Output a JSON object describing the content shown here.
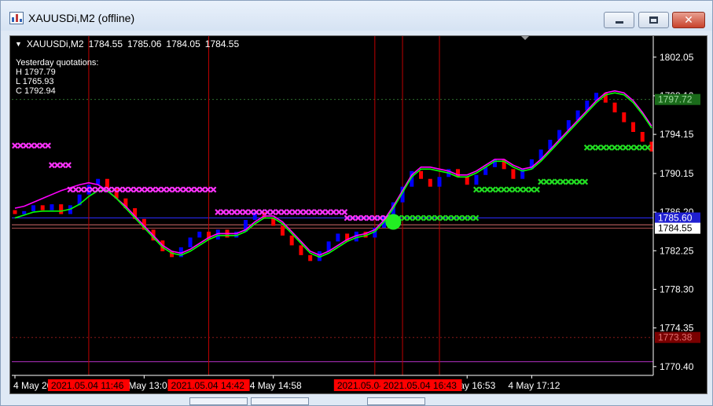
{
  "window": {
    "title": "XAUUSDi,M2 (offline)",
    "buttons": {
      "minimize": "minimize",
      "maximize": "maximize",
      "close": "✕"
    }
  },
  "header": {
    "symbol": "XAUUSDi,M2",
    "open": "1784.55",
    "high": "1785.06",
    "low": "1784.05",
    "close": "1784.55"
  },
  "yesterday": {
    "title": "Yesterday quotations:",
    "high": "H 1797.79",
    "low": "L 1765.93",
    "close": "C 1792.94"
  },
  "colors": {
    "background": "#000000",
    "bull_bar": "#0000ff",
    "bear_bar": "#ff0000",
    "upper_line": "#ff00ff",
    "lower_line": "#00ff00",
    "cross_bear": "#ff33ff",
    "cross_bull": "#22dd22",
    "vline": "#c00000",
    "date_label_bg": "#ff0000",
    "h_label_bg": "#1a6b1a",
    "l_label_bg": "#7a0000",
    "blue_level_bg": "#1f1fd0",
    "current_price_bg": "#ffffff"
  },
  "chart_data": {
    "type": "candlestick-xover",
    "y_ticks": [
      "1802.05",
      "1798.10",
      "1794.15",
      "1790.15",
      "1786.20",
      "1782.25",
      "1778.30",
      "1774.35",
      "1770.40"
    ],
    "y_tick_values": [
      1802.05,
      1798.1,
      1794.15,
      1790.15,
      1786.2,
      1782.25,
      1778.3,
      1774.35,
      1770.4
    ],
    "ylim": [
      1769.5,
      1804.2
    ],
    "x_ticks": [
      "4 May 2021",
      "4 May 13:02",
      "4 May 14:58",
      "4 May 16:53",
      "4 May 17:12"
    ],
    "x_tick_bar_index": [
      0,
      14,
      28,
      49,
      56
    ],
    "time_labels": [
      "2021.05.04 11:46",
      "2021.05.04 14:42",
      "2021.05.04 15:52",
      "2021.05.04 16:43"
    ],
    "time_label_bar_index": [
      8,
      21,
      39,
      44
    ],
    "vline_bar_index": [
      8,
      21,
      39,
      42,
      46
    ],
    "levels": [
      {
        "name": "yesterday-high",
        "value": 1797.72,
        "label": "1797.72",
        "style": "dotted-green"
      },
      {
        "name": "blue-level",
        "value": 1785.6,
        "label": "1785.60",
        "style": "solid-blue"
      },
      {
        "name": "current-price",
        "value": 1784.55,
        "label": "1784.55",
        "style": "solid-brown"
      },
      {
        "name": "pink-level",
        "value": 1784.9,
        "label": "",
        "style": "solid-pink"
      },
      {
        "name": "yesterday-low",
        "value": 1773.38,
        "label": "1773.38",
        "style": "dotted-red"
      },
      {
        "name": "purple-level",
        "value": 1770.9,
        "label": "",
        "style": "solid-purple"
      }
    ],
    "bars": [
      {
        "o": 1786.4,
        "c": 1786.0,
        "h": 1786.7,
        "l": 1785.7
      },
      {
        "o": 1786.0,
        "c": 1786.3,
        "h": 1786.6,
        "l": 1785.8
      },
      {
        "o": 1786.3,
        "c": 1786.9,
        "h": 1787.3,
        "l": 1786.1
      },
      {
        "o": 1786.9,
        "c": 1786.4,
        "h": 1787.1,
        "l": 1786.2
      },
      {
        "o": 1786.4,
        "c": 1787.0,
        "h": 1787.4,
        "l": 1786.2
      },
      {
        "o": 1787.0,
        "c": 1786.0,
        "h": 1787.2,
        "l": 1785.8
      },
      {
        "o": 1786.0,
        "c": 1786.9,
        "h": 1787.3,
        "l": 1785.9
      },
      {
        "o": 1786.9,
        "c": 1788.0,
        "h": 1788.3,
        "l": 1786.7
      },
      {
        "o": 1788.0,
        "c": 1789.0,
        "h": 1789.4,
        "l": 1787.8
      },
      {
        "o": 1789.0,
        "c": 1789.6,
        "h": 1790.0,
        "l": 1788.8
      },
      {
        "o": 1789.6,
        "c": 1788.6,
        "h": 1789.8,
        "l": 1788.4
      },
      {
        "o": 1788.6,
        "c": 1787.6,
        "h": 1788.8,
        "l": 1787.4
      },
      {
        "o": 1787.6,
        "c": 1786.6,
        "h": 1787.8,
        "l": 1786.3
      },
      {
        "o": 1786.6,
        "c": 1785.5,
        "h": 1786.8,
        "l": 1785.2
      },
      {
        "o": 1785.5,
        "c": 1784.4,
        "h": 1785.7,
        "l": 1784.1
      },
      {
        "o": 1784.4,
        "c": 1783.3,
        "h": 1784.6,
        "l": 1783.0
      },
      {
        "o": 1783.3,
        "c": 1782.2,
        "h": 1783.5,
        "l": 1781.9
      },
      {
        "o": 1782.2,
        "c": 1781.6,
        "h": 1782.5,
        "l": 1781.3
      },
      {
        "o": 1781.6,
        "c": 1782.6,
        "h": 1782.9,
        "l": 1781.4
      },
      {
        "o": 1782.6,
        "c": 1783.6,
        "h": 1783.9,
        "l": 1782.4
      },
      {
        "o": 1783.6,
        "c": 1784.2,
        "h": 1784.5,
        "l": 1783.3
      },
      {
        "o": 1784.2,
        "c": 1783.4,
        "h": 1784.4,
        "l": 1783.1
      },
      {
        "o": 1783.4,
        "c": 1784.4,
        "h": 1784.7,
        "l": 1783.2
      },
      {
        "o": 1784.4,
        "c": 1783.6,
        "h": 1784.6,
        "l": 1783.3
      },
      {
        "o": 1783.6,
        "c": 1784.2,
        "h": 1784.5,
        "l": 1783.4
      },
      {
        "o": 1784.2,
        "c": 1785.4,
        "h": 1785.7,
        "l": 1784.0
      },
      {
        "o": 1785.4,
        "c": 1786.2,
        "h": 1786.5,
        "l": 1785.2
      },
      {
        "o": 1786.2,
        "c": 1785.6,
        "h": 1786.4,
        "l": 1785.3
      },
      {
        "o": 1785.6,
        "c": 1784.8,
        "h": 1785.8,
        "l": 1784.5
      },
      {
        "o": 1784.8,
        "c": 1783.8,
        "h": 1785.0,
        "l": 1783.5
      },
      {
        "o": 1783.8,
        "c": 1782.8,
        "h": 1784.0,
        "l": 1782.5
      },
      {
        "o": 1782.8,
        "c": 1781.8,
        "h": 1783.0,
        "l": 1781.5
      },
      {
        "o": 1781.8,
        "c": 1781.2,
        "h": 1782.0,
        "l": 1780.9
      },
      {
        "o": 1781.2,
        "c": 1782.2,
        "h": 1782.5,
        "l": 1781.0
      },
      {
        "o": 1782.2,
        "c": 1783.2,
        "h": 1783.5,
        "l": 1782.0
      },
      {
        "o": 1783.2,
        "c": 1784.0,
        "h": 1784.3,
        "l": 1783.0
      },
      {
        "o": 1784.0,
        "c": 1783.2,
        "h": 1784.2,
        "l": 1783.0
      },
      {
        "o": 1783.2,
        "c": 1784.2,
        "h": 1784.5,
        "l": 1783.0
      },
      {
        "o": 1784.2,
        "c": 1783.6,
        "h": 1784.4,
        "l": 1783.4
      },
      {
        "o": 1783.6,
        "c": 1784.6,
        "h": 1784.9,
        "l": 1783.4
      },
      {
        "o": 1784.6,
        "c": 1785.8,
        "h": 1786.1,
        "l": 1784.4
      },
      {
        "o": 1785.8,
        "c": 1787.2,
        "h": 1787.5,
        "l": 1785.6
      },
      {
        "o": 1787.2,
        "c": 1788.8,
        "h": 1789.1,
        "l": 1787.0
      },
      {
        "o": 1788.8,
        "c": 1790.4,
        "h": 1790.7,
        "l": 1788.6
      },
      {
        "o": 1790.4,
        "c": 1789.6,
        "h": 1790.6,
        "l": 1789.3
      },
      {
        "o": 1789.6,
        "c": 1788.8,
        "h": 1789.8,
        "l": 1788.5
      },
      {
        "o": 1788.8,
        "c": 1789.8,
        "h": 1790.1,
        "l": 1788.6
      },
      {
        "o": 1789.8,
        "c": 1790.6,
        "h": 1790.9,
        "l": 1789.6
      },
      {
        "o": 1790.6,
        "c": 1789.8,
        "h": 1790.8,
        "l": 1789.5
      },
      {
        "o": 1789.8,
        "c": 1789.0,
        "h": 1790.0,
        "l": 1788.7
      },
      {
        "o": 1789.0,
        "c": 1790.0,
        "h": 1790.3,
        "l": 1788.8
      },
      {
        "o": 1790.0,
        "c": 1790.8,
        "h": 1791.1,
        "l": 1789.8
      },
      {
        "o": 1790.8,
        "c": 1791.6,
        "h": 1791.9,
        "l": 1790.6
      },
      {
        "o": 1791.6,
        "c": 1790.6,
        "h": 1791.8,
        "l": 1790.4
      },
      {
        "o": 1790.6,
        "c": 1789.6,
        "h": 1790.8,
        "l": 1789.4
      },
      {
        "o": 1789.6,
        "c": 1790.6,
        "h": 1790.9,
        "l": 1789.4
      },
      {
        "o": 1790.6,
        "c": 1791.6,
        "h": 1791.9,
        "l": 1790.4
      },
      {
        "o": 1791.6,
        "c": 1792.6,
        "h": 1792.9,
        "l": 1791.4
      },
      {
        "o": 1792.6,
        "c": 1793.6,
        "h": 1793.9,
        "l": 1792.4
      },
      {
        "o": 1793.6,
        "c": 1794.6,
        "h": 1794.9,
        "l": 1793.4
      },
      {
        "o": 1794.6,
        "c": 1795.6,
        "h": 1795.9,
        "l": 1794.4
      },
      {
        "o": 1795.6,
        "c": 1796.6,
        "h": 1796.9,
        "l": 1795.4
      },
      {
        "o": 1796.6,
        "c": 1797.6,
        "h": 1797.9,
        "l": 1796.4
      },
      {
        "o": 1797.6,
        "c": 1798.4,
        "h": 1798.7,
        "l": 1797.4
      },
      {
        "o": 1798.4,
        "c": 1797.4,
        "h": 1798.6,
        "l": 1797.2
      },
      {
        "o": 1797.4,
        "c": 1796.4,
        "h": 1797.6,
        "l": 1796.2
      },
      {
        "o": 1796.4,
        "c": 1795.4,
        "h": 1796.6,
        "l": 1795.2
      },
      {
        "o": 1795.4,
        "c": 1794.4,
        "h": 1795.6,
        "l": 1794.2
      },
      {
        "o": 1794.4,
        "c": 1793.4,
        "h": 1794.6,
        "l": 1793.2
      },
      {
        "o": 1793.4,
        "c": 1792.4,
        "h": 1793.6,
        "l": 1792.2
      }
    ],
    "upper_line": [
      1786.6,
      1786.8,
      1787.2,
      1787.6,
      1788.0,
      1788.4,
      1788.7,
      1789.0,
      1789.2,
      1789.0,
      1788.4,
      1787.6,
      1786.8,
      1785.8,
      1784.8,
      1783.8,
      1782.8,
      1782.2,
      1782.0,
      1782.4,
      1783.0,
      1783.6,
      1784.0,
      1784.0,
      1784.0,
      1784.4,
      1785.2,
      1785.8,
      1785.8,
      1785.2,
      1784.2,
      1783.2,
      1782.2,
      1781.8,
      1782.2,
      1782.8,
      1783.4,
      1783.8,
      1784.0,
      1784.4,
      1785.4,
      1786.8,
      1788.4,
      1790.0,
      1790.8,
      1790.8,
      1790.6,
      1790.4,
      1790.0,
      1790.0,
      1790.4,
      1791.0,
      1791.6,
      1791.6,
      1791.0,
      1790.6,
      1790.8,
      1791.6,
      1792.6,
      1793.6,
      1794.6,
      1795.6,
      1796.6,
      1797.6,
      1798.4,
      1798.6,
      1798.4,
      1797.6,
      1796.4,
      1795.0
    ],
    "lower_line": [
      1785.6,
      1785.9,
      1786.2,
      1786.3,
      1786.3,
      1786.3,
      1786.5,
      1787.0,
      1787.8,
      1788.4,
      1788.4,
      1787.6,
      1786.6,
      1785.6,
      1784.6,
      1783.6,
      1782.6,
      1782.0,
      1781.8,
      1782.2,
      1782.8,
      1783.4,
      1783.8,
      1783.8,
      1783.8,
      1784.2,
      1785.0,
      1785.6,
      1785.6,
      1785.0,
      1784.0,
      1783.0,
      1782.0,
      1781.6,
      1782.0,
      1782.6,
      1783.2,
      1783.6,
      1783.8,
      1784.2,
      1785.2,
      1786.6,
      1788.2,
      1789.8,
      1790.6,
      1790.6,
      1790.4,
      1790.2,
      1789.8,
      1789.8,
      1790.2,
      1790.8,
      1791.4,
      1791.4,
      1790.8,
      1790.4,
      1790.6,
      1791.4,
      1792.4,
      1793.4,
      1794.4,
      1795.4,
      1796.4,
      1797.4,
      1798.2,
      1798.4,
      1798.2,
      1797.4,
      1796.2,
      1794.8
    ],
    "cross_segments": [
      {
        "trend": "bear",
        "value": 1793.0,
        "from": 0,
        "to": 4
      },
      {
        "trend": "bear",
        "value": 1791.0,
        "from": 4,
        "to": 6
      },
      {
        "trend": "bear",
        "value": 1788.5,
        "from": 6,
        "to": 22
      },
      {
        "trend": "bear",
        "value": 1786.2,
        "from": 22,
        "to": 36
      },
      {
        "trend": "bear",
        "value": 1785.6,
        "from": 36,
        "to": 41
      },
      {
        "trend": "bull",
        "value": 1785.6,
        "from": 41,
        "to": 50
      },
      {
        "trend": "bull",
        "value": 1788.5,
        "from": 50,
        "to": 57
      },
      {
        "trend": "bull",
        "value": 1789.3,
        "from": 57,
        "to": 62
      },
      {
        "trend": "bull",
        "value": 1792.8,
        "from": 62,
        "to": 69
      }
    ],
    "signal_dot": {
      "bar_index": 41,
      "value": 1785.2
    }
  }
}
